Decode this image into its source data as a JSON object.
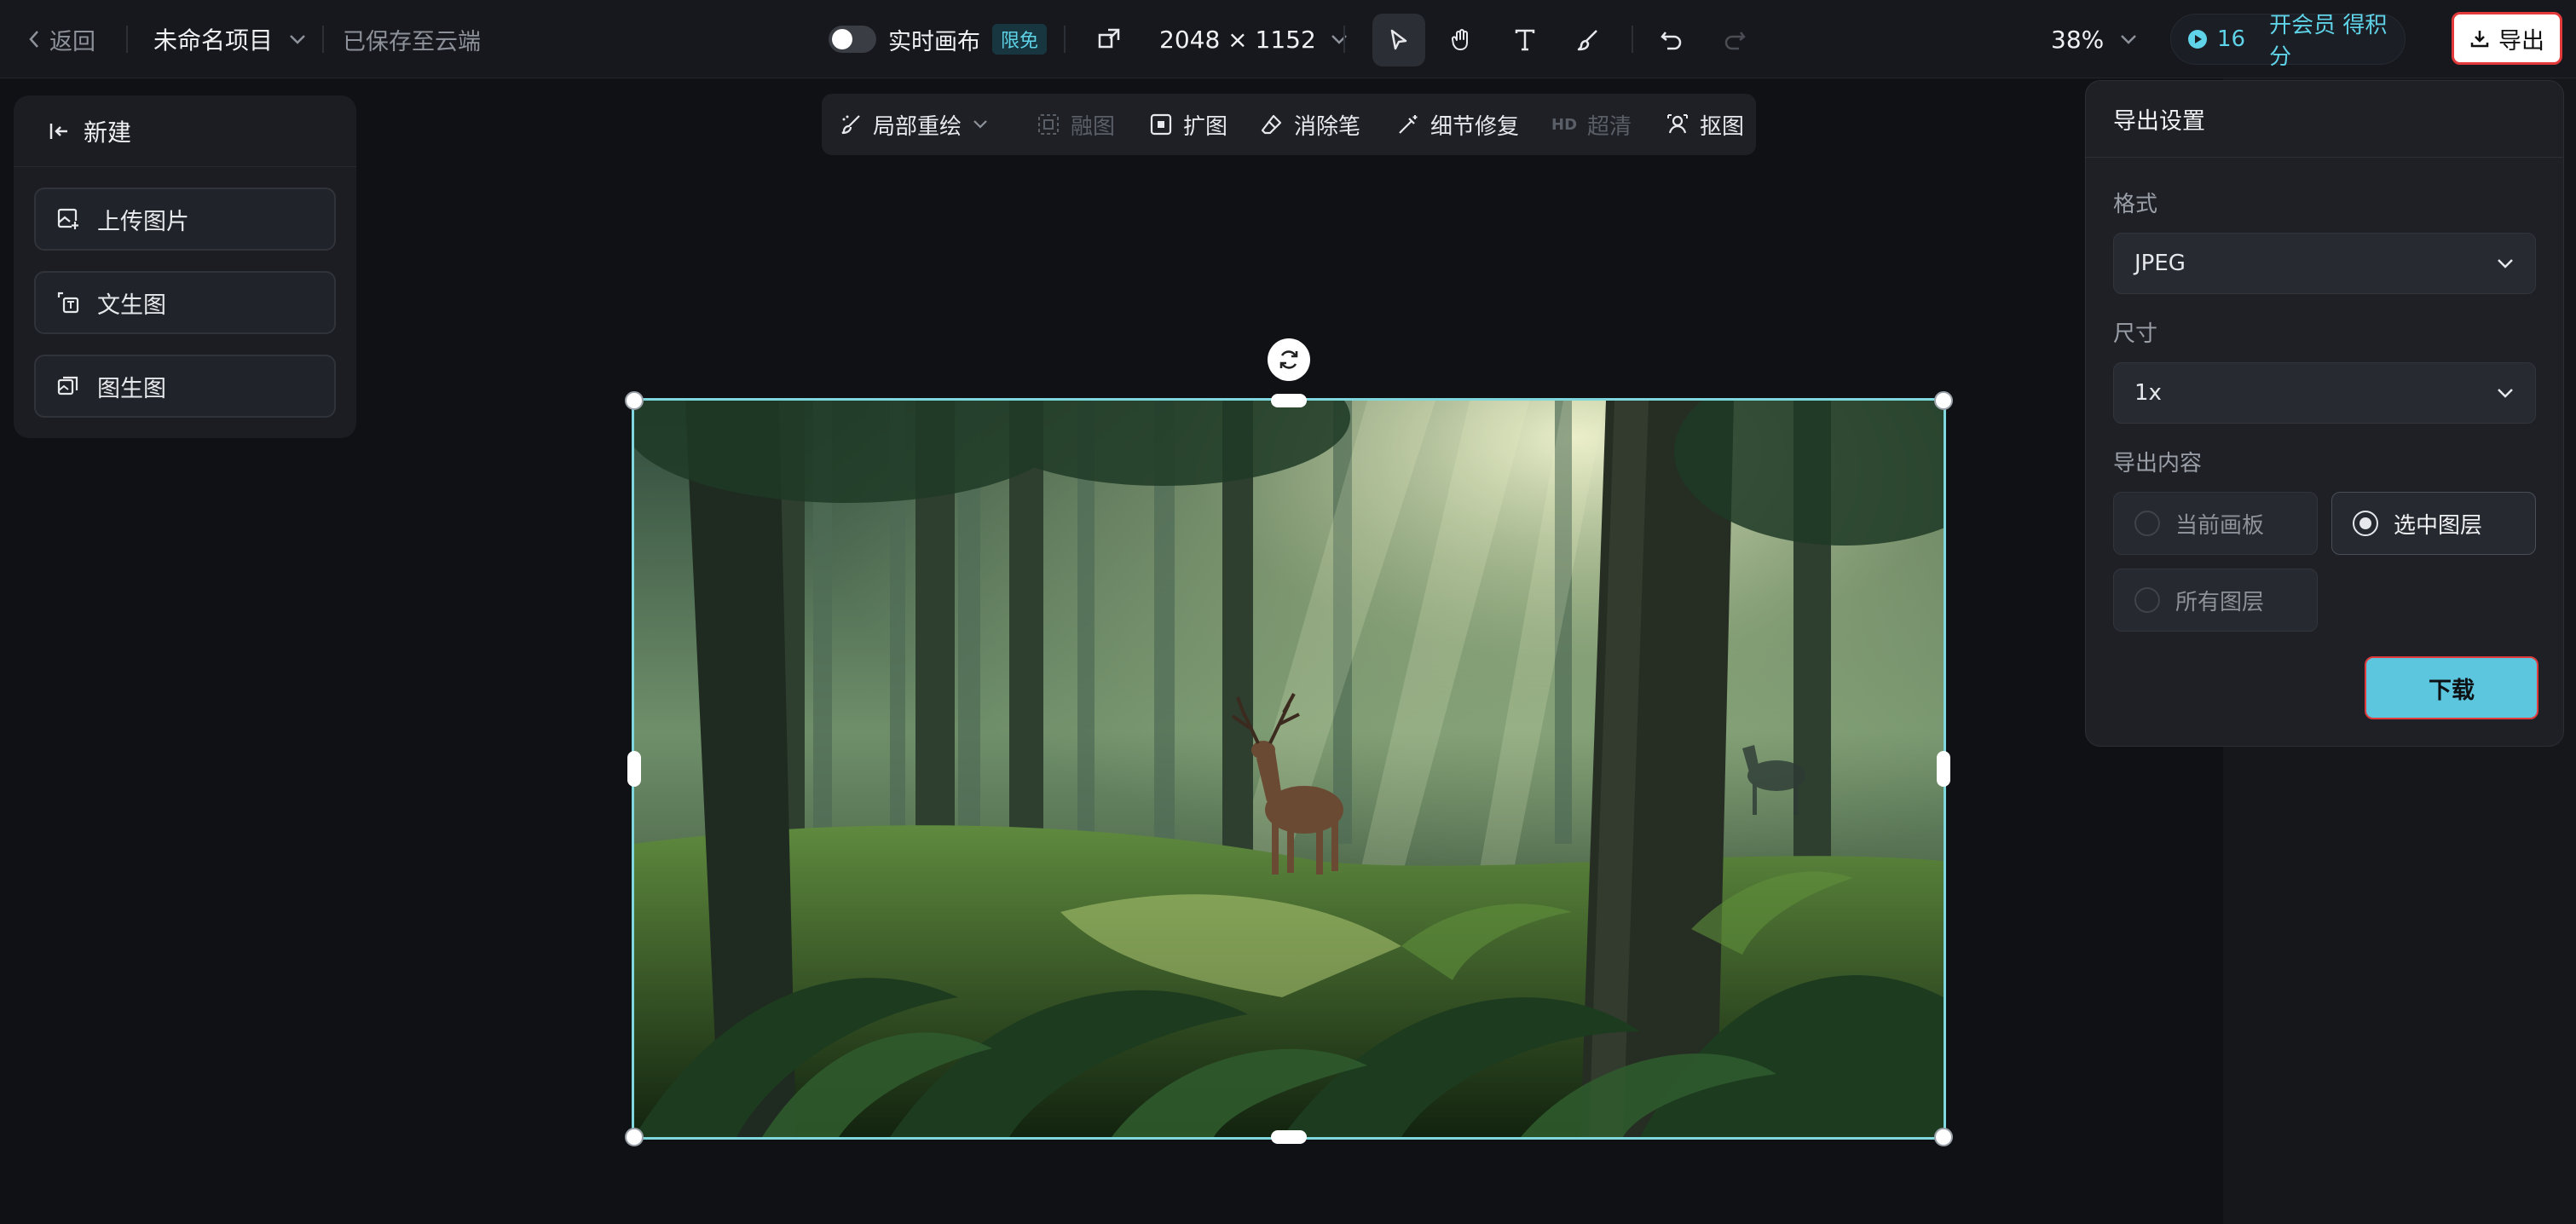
{
  "topbar": {
    "back_label": "返回",
    "project_name": "未命名项目",
    "saved_status": "已保存至云端",
    "realtime_label": "实时画布",
    "realtime_badge": "限免",
    "canvas_size": "2048 × 1152",
    "zoom": "38%",
    "credits": "16",
    "vip_label": "开会员 得积分",
    "export_label": "导出"
  },
  "left_panel": {
    "header": "新建",
    "items": [
      {
        "label": "上传图片",
        "icon": "upload-image-icon"
      },
      {
        "label": "文生图",
        "icon": "text-to-image-icon"
      },
      {
        "label": "图生图",
        "icon": "image-to-image-icon"
      }
    ]
  },
  "canvas_toolbar": {
    "items": [
      {
        "label": "局部重绘",
        "icon": "inpaint-brush-icon",
        "enabled": true
      },
      {
        "label": "融图",
        "icon": "blend-icon",
        "enabled": false
      },
      {
        "label": "扩图",
        "icon": "expand-icon",
        "enabled": true
      },
      {
        "label": "消除笔",
        "icon": "eraser-icon",
        "enabled": true
      },
      {
        "label": "细节修复",
        "icon": "magic-wand-icon",
        "enabled": true
      },
      {
        "label": "超清",
        "prefix": "HD",
        "icon": "hd-icon",
        "enabled": false
      },
      {
        "label": "抠图",
        "icon": "cutout-icon",
        "enabled": true
      }
    ]
  },
  "export_panel": {
    "title": "导出设置",
    "format_label": "格式",
    "format_value": "JPEG",
    "size_label": "尺寸",
    "size_value": "1x",
    "content_label": "导出内容",
    "options": [
      {
        "label": "当前画板",
        "selected": false
      },
      {
        "label": "选中图层",
        "selected": true
      },
      {
        "label": "所有图层",
        "selected": false
      }
    ],
    "download_label": "下载"
  },
  "colors": {
    "accent": "#5fd3e8",
    "selection": "#7fd8de",
    "download_button": "#5cc6de"
  }
}
